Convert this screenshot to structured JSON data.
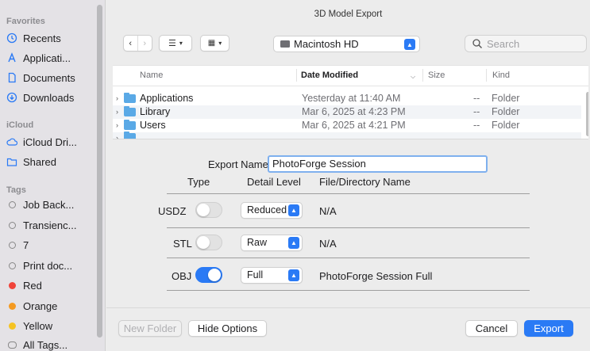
{
  "window": {
    "title": "3D Model Export"
  },
  "sidebar": {
    "favorites_heading": "Favorites",
    "favorites": [
      {
        "label": "Recents",
        "icon": "clock-icon"
      },
      {
        "label": "Applicati...",
        "icon": "applications-icon"
      },
      {
        "label": "Documents",
        "icon": "document-icon"
      },
      {
        "label": "Downloads",
        "icon": "download-icon"
      }
    ],
    "icloud_heading": "iCloud",
    "icloud": [
      {
        "label": "iCloud Dri...",
        "icon": "cloud-icon"
      },
      {
        "label": "Shared",
        "icon": "shared-folder-icon"
      }
    ],
    "tags_heading": "Tags",
    "tags": [
      {
        "label": "Job Back...",
        "color": ""
      },
      {
        "label": "Transienc...",
        "color": ""
      },
      {
        "label": "7",
        "color": ""
      },
      {
        "label": "Print doc...",
        "color": ""
      },
      {
        "label": "Red",
        "color": "#f0443a"
      },
      {
        "label": "Orange",
        "color": "#f49a21"
      },
      {
        "label": "Yellow",
        "color": "#f5c323"
      },
      {
        "label": "All Tags...",
        "color": ""
      }
    ]
  },
  "toolbar": {
    "location": "Macintosh HD",
    "search_placeholder": "Search"
  },
  "file_list": {
    "columns": {
      "name": "Name",
      "date": "Date Modified",
      "size": "Size",
      "kind": "Kind"
    },
    "rows": [
      {
        "name": "Applications",
        "date": "Yesterday at 11:40 AM",
        "size": "--",
        "kind": "Folder"
      },
      {
        "name": "Library",
        "date": "Mar 6, 2025 at 4:23 PM",
        "size": "--",
        "kind": "Folder"
      },
      {
        "name": "Users",
        "date": "Mar 6, 2025 at 4:21 PM",
        "size": "--",
        "kind": "Folder"
      }
    ]
  },
  "options": {
    "export_name_label": "Export Name",
    "export_name_value": "PhotoForge Session",
    "headers": {
      "type": "Type",
      "detail": "Detail Level",
      "file": "File/Directory Name"
    },
    "rows": [
      {
        "type": "USDZ",
        "enabled": false,
        "detail": "Reduced",
        "file": "N/A"
      },
      {
        "type": "STL",
        "enabled": false,
        "detail": "Raw",
        "file": "N/A"
      },
      {
        "type": "OBJ",
        "enabled": true,
        "detail": "Full",
        "file": "PhotoForge Session Full"
      }
    ]
  },
  "buttons": {
    "new_folder": "New Folder",
    "hide_options": "Hide Options",
    "cancel": "Cancel",
    "export": "Export"
  },
  "colors": {
    "accent": "#2a7af5",
    "folder": "#5aa9e6"
  }
}
